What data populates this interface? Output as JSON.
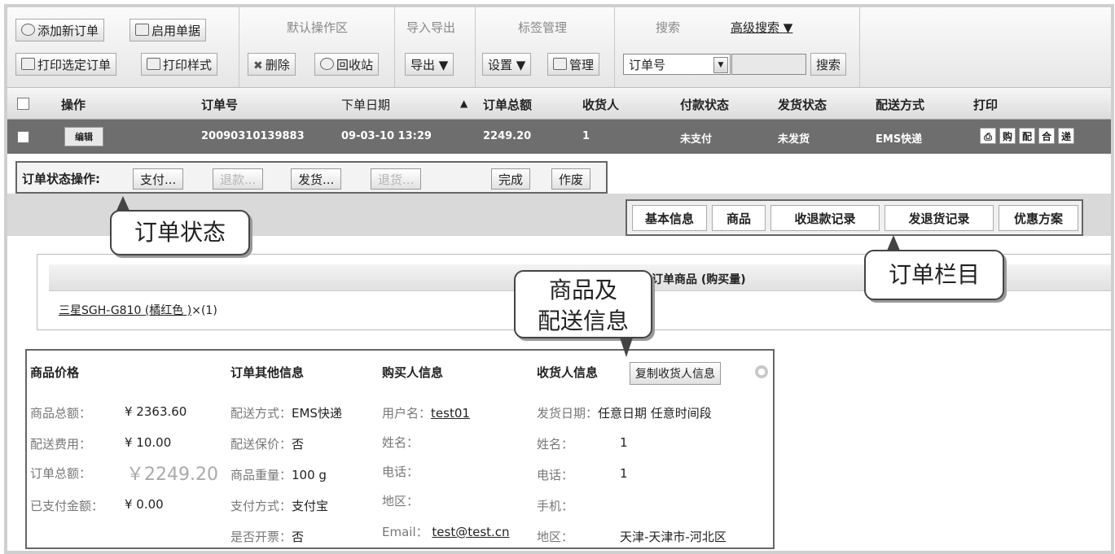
{
  "toolbar": {
    "add_order": "添加新订单",
    "enable_doc": "启用单据",
    "print_selected": "打印选定订单",
    "print_style": "打印样式",
    "default_group_title": "默认操作区",
    "delete": "删除",
    "recycle": "回收站",
    "io_group_title": "导入导出",
    "export": "导出",
    "tag_group_title": "标签管理",
    "settings": "设置",
    "manage": "管理",
    "search_group_title": "搜索",
    "advanced_search": "高级搜索",
    "search_field_value": "订单号",
    "search_button": "搜索"
  },
  "table": {
    "headers": [
      "操作",
      "订单号",
      "下单日期",
      "订单总额",
      "收货人",
      "付款状态",
      "发货状态",
      "配送方式",
      "打印"
    ],
    "row": {
      "edit": "编辑",
      "order_no": "20090310139883",
      "date": "09-03-10 13:29",
      "total": "2249.20",
      "consignee": "1",
      "pay_status": "未支付",
      "ship_status": "未发货",
      "ship_method": "EMS快递",
      "print_buttons": [
        "购",
        "配",
        "合",
        "递"
      ]
    }
  },
  "status_ops": {
    "label": "订单状态操作:",
    "buttons": [
      "支付...",
      "退款...",
      "发货...",
      "退货...",
      "完成",
      "作废"
    ]
  },
  "tabs": [
    "基本信息",
    "商品",
    "收退款记录",
    "发退货记录",
    "优惠方案"
  ],
  "goods": {
    "title": "订单商品 (购买量)",
    "item_name": "三星SGH-G810 (橘红色 )",
    "item_qty": "×(1)"
  },
  "info": {
    "price": {
      "header": "商品价格",
      "rows": [
        {
          "label": "商品总额：",
          "value": "¥ 2363.60"
        },
        {
          "label": "配送费用：",
          "value": "¥ 10.00"
        },
        {
          "label": "订单总额：",
          "value": "￥2249.20"
        },
        {
          "label": "已支付金额：",
          "value": "¥ 0.00"
        }
      ]
    },
    "other": {
      "header": "订单其他信息",
      "rows": [
        {
          "label": "配送方式：",
          "value": "EMS快递"
        },
        {
          "label": "配送保价：",
          "value": "否"
        },
        {
          "label": "商品重量：",
          "value": "100 g"
        },
        {
          "label": "支付方式：",
          "value": "支付宝"
        },
        {
          "label": "是否开票：",
          "value": "否"
        }
      ]
    },
    "buyer": {
      "header": "购买人信息",
      "rows": [
        {
          "label": "用户名：",
          "value": "test01"
        },
        {
          "label": "姓名：",
          "value": ""
        },
        {
          "label": "电话：",
          "value": ""
        },
        {
          "label": "地区：",
          "value": ""
        },
        {
          "label": "Email：",
          "value": "test@test.cn"
        }
      ]
    },
    "receiver": {
      "header": "收货人信息",
      "copy_button": "复制收货人信息",
      "rows": [
        {
          "label": "发货日期：",
          "value": "任意日期 任意时间段"
        },
        {
          "label": "姓名：",
          "value": "1"
        },
        {
          "label": "电话：",
          "value": "1"
        },
        {
          "label": "手机：",
          "value": ""
        },
        {
          "label": "地区：",
          "value": "天津-天津市-河北区"
        }
      ]
    }
  },
  "callouts": {
    "order_status": "订单状态",
    "order_columns": "订单栏目",
    "goods_shipping_line1": "商品及",
    "goods_shipping_line2": "配送信息"
  }
}
